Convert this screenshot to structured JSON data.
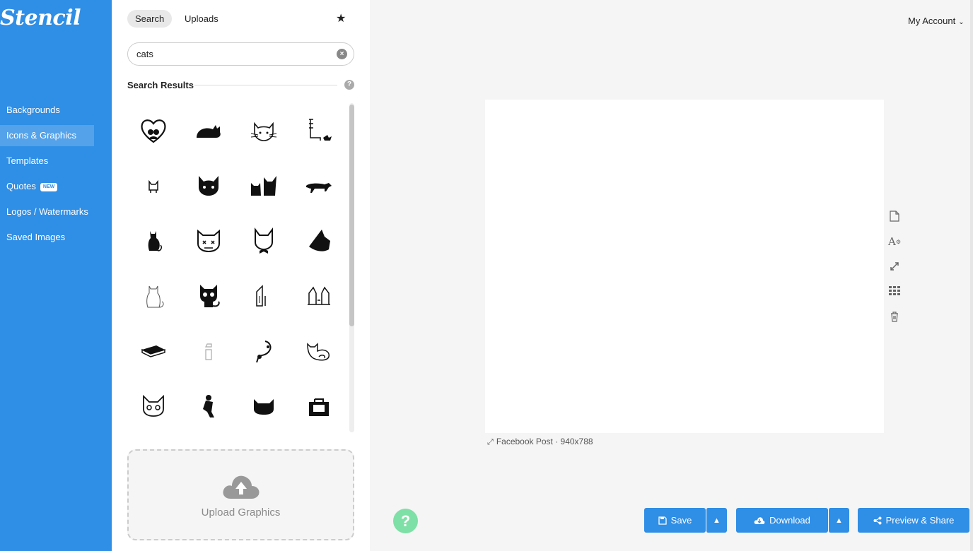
{
  "brand": {
    "logo": "Stencil",
    "accent": "#2f8ee5"
  },
  "nav": {
    "items": [
      {
        "label": "Backgrounds"
      },
      {
        "label": "Icons & Graphics",
        "active": true
      },
      {
        "label": "Templates"
      },
      {
        "label": "Quotes",
        "badge": "NEW"
      },
      {
        "label": "Logos / Watermarks"
      },
      {
        "label": "Saved Images"
      }
    ]
  },
  "panel": {
    "tabs": [
      {
        "label": "Search",
        "active": true
      },
      {
        "label": "Uploads"
      }
    ],
    "search": {
      "value": "cats",
      "placeholder": ""
    },
    "results_title": "Search Results",
    "upload_label": "Upload Graphics"
  },
  "header": {
    "account_label": "My Account"
  },
  "canvas": {
    "info": "Facebook Post · 940x788"
  },
  "actions": {
    "save_label": "Save",
    "download_label": "Download",
    "preview_label": "Preview & Share"
  }
}
